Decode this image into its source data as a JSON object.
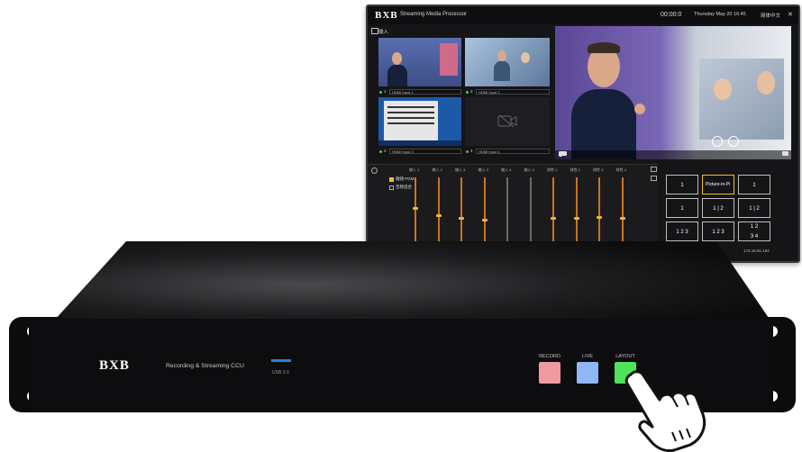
{
  "monitor": {
    "logo": "BXB",
    "app_title": "Streaming Media Processor",
    "datetime": "Thursday May 20 16:45",
    "language": "简体中文",
    "close_glyph": "✕",
    "inputs_header": "输入",
    "program_timer": "00:00:0",
    "inputs": [
      {
        "num": "1",
        "source": "HDMI Input 1"
      },
      {
        "num": "2",
        "source": "HDMI Input 2"
      },
      {
        "num": "3",
        "source": "HDMI Input 3"
      },
      {
        "num": "4",
        "source": "HDMI Input 4"
      }
    ],
    "audio": {
      "options": [
        "跟随 PGM",
        "音频混合"
      ],
      "channels": [
        "输入 1",
        "输入 2",
        "输入 3",
        "输入 3",
        "输入 4",
        "输入 4",
        "线性 1",
        "线性 2",
        "线性 3",
        "线性 4"
      ],
      "levels": [
        0.55,
        0.45,
        0.4,
        0.38,
        0.0,
        0.0,
        0.4,
        0.4,
        0.42,
        0.4
      ]
    },
    "layouts": {
      "active": "Picture-in-Pi",
      "ip": "172.16.81.184"
    }
  },
  "device": {
    "logo": "BXB",
    "name": "Recording & Streaming CCU",
    "usb_label": "USB 3.0",
    "buttons": [
      {
        "label": "RECORD",
        "color": "#ef9aa0"
      },
      {
        "label": "LIVE",
        "color": "#8fb7f3"
      },
      {
        "label": "LAYOUT",
        "color": "#4ee35a"
      }
    ]
  }
}
